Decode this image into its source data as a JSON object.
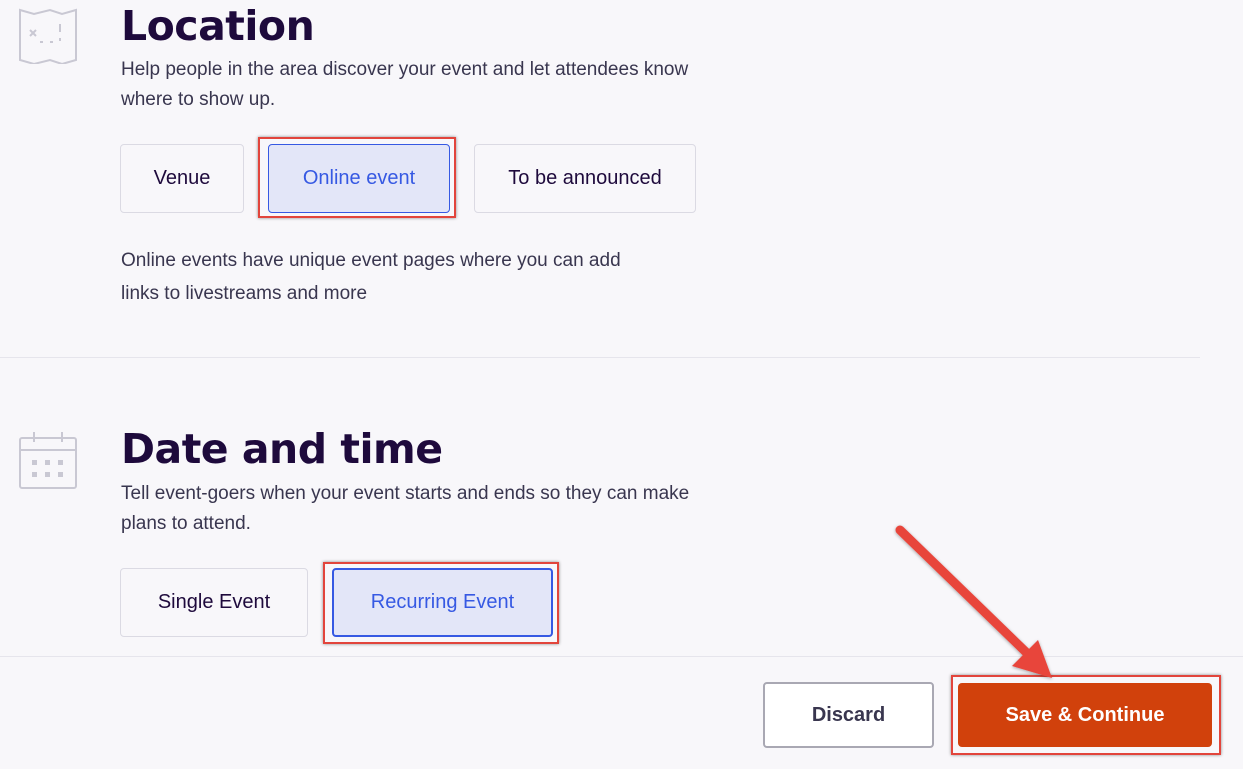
{
  "location": {
    "title": "Location",
    "description_line1": "Help people in the area discover your event and let attendees know",
    "description_line2": "where to show up.",
    "options": [
      {
        "label": "Venue",
        "selected": false
      },
      {
        "label": "Online event",
        "selected": true
      },
      {
        "label": "To be announced",
        "selected": false
      }
    ],
    "note_line1": "Online events have unique event pages where you can add",
    "note_line2": "links to livestreams and more",
    "icon": "map-icon"
  },
  "date_time": {
    "title": "Date and time",
    "description_line1": "Tell event-goers when your event starts and ends so they can make",
    "description_line2": "plans to attend.",
    "options": [
      {
        "label": "Single Event",
        "selected": false
      },
      {
        "label": "Recurring Event",
        "selected": true
      }
    ],
    "icon": "calendar-icon"
  },
  "footer": {
    "discard_label": "Discard",
    "save_label": "Save & Continue"
  },
  "colors": {
    "accent": "#3659e3",
    "primary_button": "#d1410c",
    "highlight": "#e2453c",
    "heading": "#1e0a3c"
  }
}
